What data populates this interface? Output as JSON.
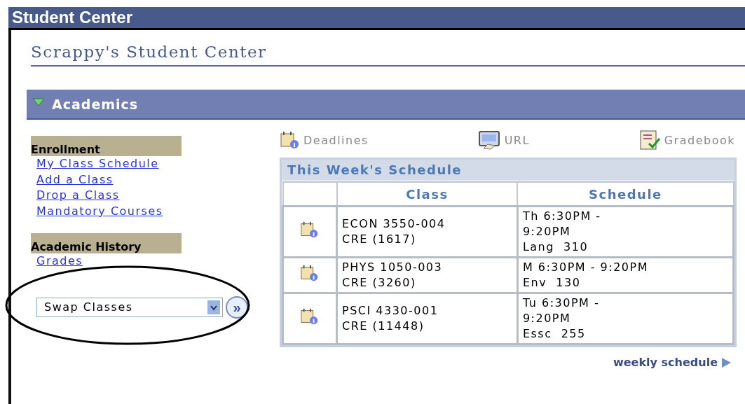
{
  "window": {
    "title": "Student Center"
  },
  "page_title": "Scrappy's Student Center",
  "section": {
    "title": "Academics",
    "expanded": true
  },
  "sidebar": {
    "groups": [
      {
        "heading": "Enrollment",
        "links": [
          "My Class Schedule",
          "Add a Class",
          "Drop a Class",
          "Mandatory Courses"
        ]
      },
      {
        "heading": "Academic History",
        "links": [
          "Grades"
        ]
      }
    ],
    "dropdown": {
      "value": "Swap Classes"
    },
    "go_button": "»"
  },
  "toolbar": [
    {
      "kind": "deadlines",
      "label": "Deadlines"
    },
    {
      "kind": "url",
      "label": "URL"
    },
    {
      "kind": "gradebook",
      "label": "Gradebook"
    }
  ],
  "schedule": {
    "title": "This Week's Schedule",
    "columns": [
      "Class",
      "Schedule"
    ],
    "rows": [
      {
        "class": [
          "ECON 3550-004",
          "CRE (1617)"
        ],
        "schedule": [
          "Th 6:30PM -",
          "9:20PM",
          "Lang  310"
        ]
      },
      {
        "class": [
          "PHYS 1050-003",
          "CRE (3260)"
        ],
        "schedule": [
          "M 6:30PM - 9:20PM",
          "Env  130"
        ]
      },
      {
        "class": [
          "PSCI 4330-001",
          "CRE (11448)"
        ],
        "schedule": [
          "Tu 6:30PM -",
          "9:20PM",
          "Essc  255"
        ]
      }
    ],
    "footer_link": "weekly schedule"
  }
}
